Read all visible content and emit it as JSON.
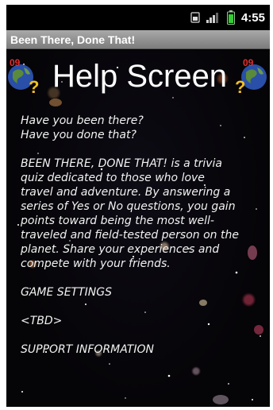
{
  "status_bar": {
    "time": "4:55",
    "icons": [
      "sim-icon",
      "signal-icon",
      "battery-icon"
    ]
  },
  "app": {
    "title": "Been There, Done That!"
  },
  "screen": {
    "heading": "Help Screen",
    "question_line_1": "Have you been there?",
    "question_line_2": "Have you done that?",
    "description": [
      "BEEN THERE, DONE THAT! is a trivia",
      "quiz dedicated to those who love",
      "travel and adventure. By answering a",
      "series of Yes or No questions, you gain",
      "points toward being the most well-",
      "traveled and field-tested person on the",
      "planet. Share your experiences and",
      "compete with your friends."
    ],
    "game_settings_heading": "GAME SETTINGS",
    "game_settings_body": "<TBD>",
    "support_heading": "SUPPORT INFORMATION"
  },
  "colors": {
    "title_bar": "#8e8e8e",
    "background": "#000000",
    "text": "#ffffff"
  }
}
